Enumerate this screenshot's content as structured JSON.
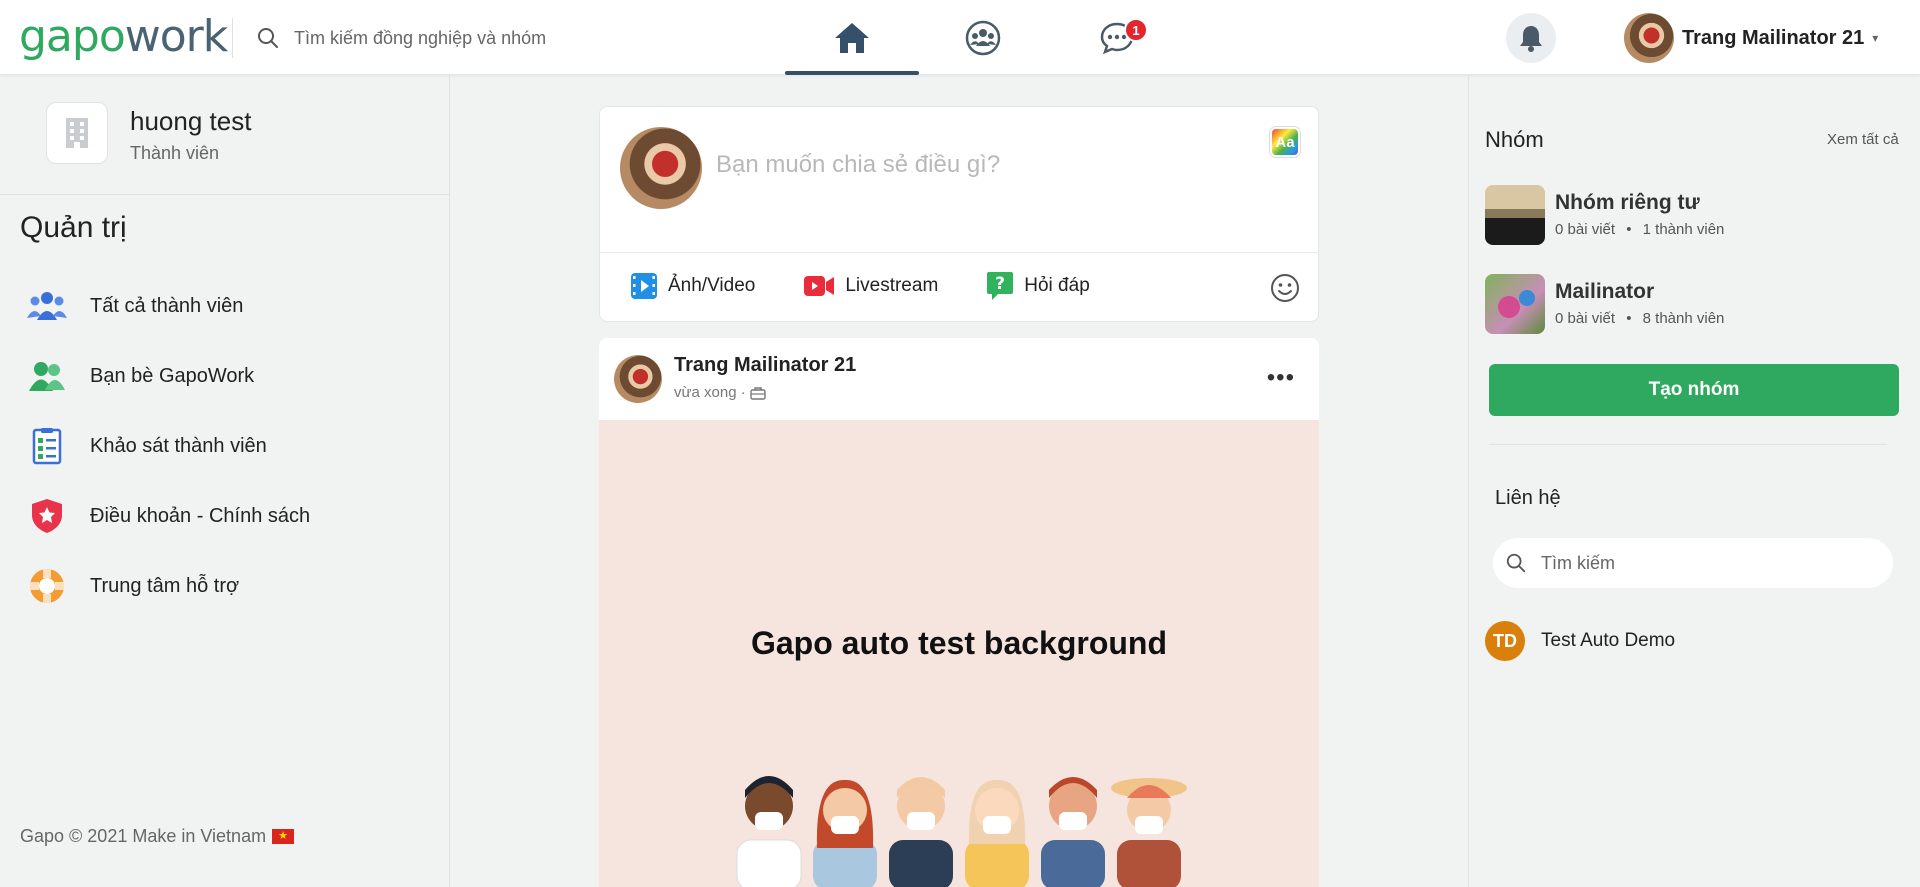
{
  "header": {
    "logo_part1": "gapo",
    "logo_part2": "work",
    "search_placeholder": "Tìm kiếm đồng nghiệp và nhóm",
    "chat_badge": "1",
    "user_name": "Trang Mailinator 21",
    "caret": "▾",
    "accent_color": "#30a960",
    "active_tab_color": "#35506a"
  },
  "left": {
    "org_name": "huong test",
    "org_role": "Thành viên",
    "admin_title": "Quản trị",
    "menu": [
      {
        "label": "Tất cả thành viên",
        "icon": "members-icon"
      },
      {
        "label": "Bạn bè GapoWork",
        "icon": "friends-icon"
      },
      {
        "label": "Khảo sát thành viên",
        "icon": "survey-icon"
      },
      {
        "label": "Điều khoản - Chính sách",
        "icon": "shield-star-icon"
      },
      {
        "label": "Trung tâm hỗ trợ",
        "icon": "lifebuoy-icon"
      }
    ],
    "footer": "Gapo © 2021 Make in Vietnam"
  },
  "composer": {
    "placeholder": "Bạn muốn chia sẻ điều gì?",
    "format_button": "Aa",
    "actions": [
      {
        "label": "Ảnh/Video",
        "icon": "photo-video-icon"
      },
      {
        "label": "Livestream",
        "icon": "livestream-icon"
      },
      {
        "label": "Hỏi đáp",
        "icon": "question-icon"
      }
    ]
  },
  "post": {
    "author": "Trang Mailinator 21",
    "time": "vừa xong",
    "separator": "·",
    "menu": "•••",
    "background_text": "Gapo auto test background",
    "background_color": "#f6e5df"
  },
  "right": {
    "groups_title": "Nhóm",
    "see_all": "Xem tất cả",
    "groups": [
      {
        "name": "Nhóm riêng tư",
        "posts": "0 bài viết",
        "members": "1 thành viên"
      },
      {
        "name": "Mailinator",
        "posts": "0 bài viết",
        "members": "8 thành viên"
      }
    ],
    "create_group": "Tạo nhóm",
    "contacts_title": "Liên hệ",
    "contact_search_placeholder": "Tìm kiếm",
    "contacts": [
      {
        "initials": "TD",
        "name": "Test Auto Demo"
      }
    ]
  }
}
